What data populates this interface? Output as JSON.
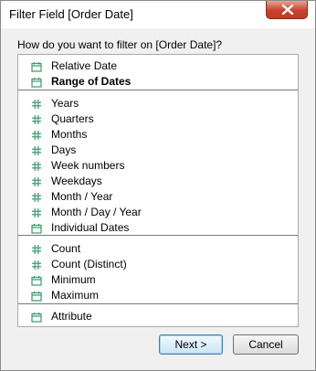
{
  "window": {
    "title": "Filter Field [Order Date]"
  },
  "prompt": "How do you want to filter on [Order Date]?",
  "colors": {
    "icon_green": "#3a9a6c",
    "selected_separator": "#7a7a7a",
    "default_button_border": "#3c7fb1"
  },
  "items": [
    {
      "label": "Relative Date",
      "icon": "calendar-icon"
    },
    {
      "label": "Range of Dates",
      "icon": "calendar-icon",
      "bold": true
    },
    {
      "label": "Years",
      "icon": "hash-icon"
    },
    {
      "label": "Quarters",
      "icon": "hash-icon"
    },
    {
      "label": "Months",
      "icon": "hash-icon"
    },
    {
      "label": "Days",
      "icon": "hash-icon"
    },
    {
      "label": "Week numbers",
      "icon": "hash-icon"
    },
    {
      "label": "Weekdays",
      "icon": "hash-icon"
    },
    {
      "label": "Month / Year",
      "icon": "hash-icon"
    },
    {
      "label": "Month / Day / Year",
      "icon": "hash-icon"
    },
    {
      "label": "Individual Dates",
      "icon": "calendar-icon"
    },
    {
      "label": "Count",
      "icon": "hash-icon"
    },
    {
      "label": "Count (Distinct)",
      "icon": "hash-icon"
    },
    {
      "label": "Minimum",
      "icon": "calendar-icon"
    },
    {
      "label": "Maximum",
      "icon": "calendar-icon"
    },
    {
      "label": "Attribute",
      "icon": "calendar-icon"
    }
  ],
  "buttons": {
    "next": "Next >",
    "cancel": "Cancel"
  }
}
